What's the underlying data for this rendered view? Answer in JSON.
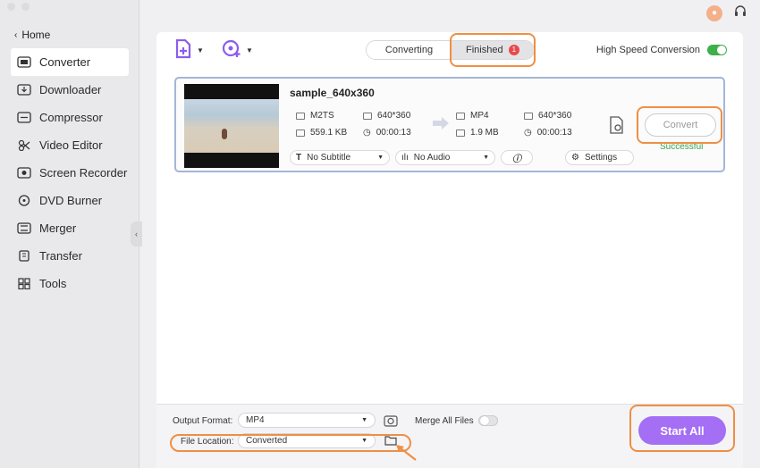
{
  "sidebar": {
    "home_label": "Home",
    "items": [
      {
        "label": "Converter",
        "icon": "converter-icon"
      },
      {
        "label": "Downloader",
        "icon": "downloader-icon"
      },
      {
        "label": "Compressor",
        "icon": "compressor-icon"
      },
      {
        "label": "Video Editor",
        "icon": "video-editor-icon"
      },
      {
        "label": "Screen Recorder",
        "icon": "screen-recorder-icon"
      },
      {
        "label": "DVD Burner",
        "icon": "dvd-burner-icon"
      },
      {
        "label": "Merger",
        "icon": "merger-icon"
      },
      {
        "label": "Transfer",
        "icon": "transfer-icon"
      },
      {
        "label": "Tools",
        "icon": "tools-icon"
      }
    ]
  },
  "tabs": {
    "converting": "Converting",
    "finished": "Finished",
    "finished_count": "1"
  },
  "high_speed": {
    "label": "High Speed Conversion",
    "enabled": true
  },
  "file": {
    "name": "sample_640x360",
    "source": {
      "format": "M2TS",
      "resolution": "640*360",
      "size": "559.1 KB",
      "duration": "00:00:13"
    },
    "target": {
      "format": "MP4",
      "resolution": "640*360",
      "size": "1.9 MB",
      "duration": "00:00:13"
    },
    "subtitle": "No Subtitle",
    "audio": "No Audio",
    "settings_label": "Settings",
    "convert_label": "Convert",
    "status": "Successful"
  },
  "bottom": {
    "output_format_label": "Output Format:",
    "output_format_value": "MP4",
    "merge_label": "Merge All Files",
    "file_location_label": "File Location:",
    "file_location_value": "Converted",
    "start_all_label": "Start All"
  },
  "colors": {
    "accent": "#a46ef5",
    "highlight": "#ef8f44",
    "success": "#3aa14a",
    "badge": "#e8484e"
  }
}
